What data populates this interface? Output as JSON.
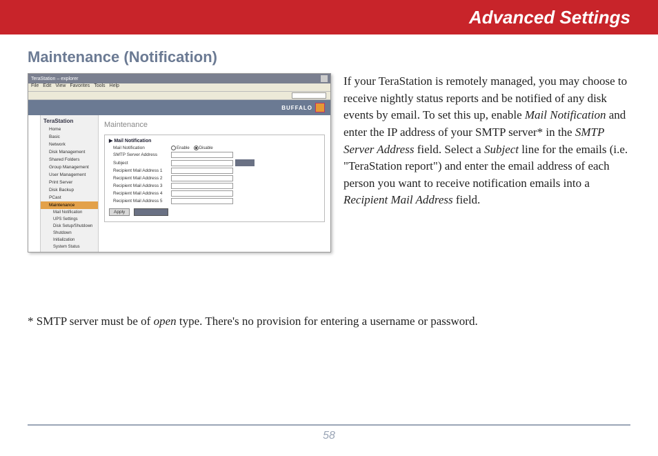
{
  "header": {
    "title": "Advanced Settings"
  },
  "section": {
    "title": "Maintenance (Notification)"
  },
  "screenshot": {
    "window_title": "TeraStation – explorer",
    "menus": [
      "File",
      "Edit",
      "View",
      "Favorites",
      "Tools",
      "Help"
    ],
    "brand": "BUFFALO",
    "sidebar_header": "TeraStation",
    "sidebar": [
      "Home",
      "Basic",
      "Network",
      "Disk Management",
      "Shared Folders",
      "Group Management",
      "User Management",
      "Print Server",
      "Disk Backup",
      "PCast"
    ],
    "sidebar_selected": "Maintenance",
    "sidebar_sub": [
      "Mail Notification",
      "UPS Settings",
      "Disk Setup/Shutdown",
      "Shutdown",
      "Initialization",
      "System Status"
    ],
    "main_title": "Maintenance",
    "panel_title": "Mail Notification",
    "rows": {
      "mail_notification": "Mail Notification",
      "enable": "Enable",
      "disable": "Disable",
      "smtp": "SMTP Server Address",
      "subject": "Subject",
      "r1": "Recipient Mail Address 1",
      "r2": "Recipient Mail Address 2",
      "r3": "Recipient Mail Address 3",
      "r4": "Recipient Mail Address 4",
      "r5": "Recipient Mail Address 5"
    },
    "buttons": {
      "apply": "Apply",
      "cancel": ""
    }
  },
  "body": {
    "p1a": "If your TeraStation is remotely managed, you may choose to receive nightly status reports and be notified of any disk events by email. To set this up, enable ",
    "p1b": "Mail Notification",
    "p1c": " and enter the IP address of your SMTP server* in the ",
    "p1d": "SMTP Server Address",
    "p1e": " field.  Select a ",
    "p1f": "Subject",
    "p1g": " line for the emails (i.e. \"TeraStation report\") and enter the email address of each person you want to receive  notification emails into a ",
    "p1h": "Recipient Mail Address",
    "p1i": " field."
  },
  "footnote": {
    "a": "* SMTP server must be of ",
    "b": "open",
    "c": " type.  There's no provision for entering a username or password."
  },
  "page_number": "58"
}
